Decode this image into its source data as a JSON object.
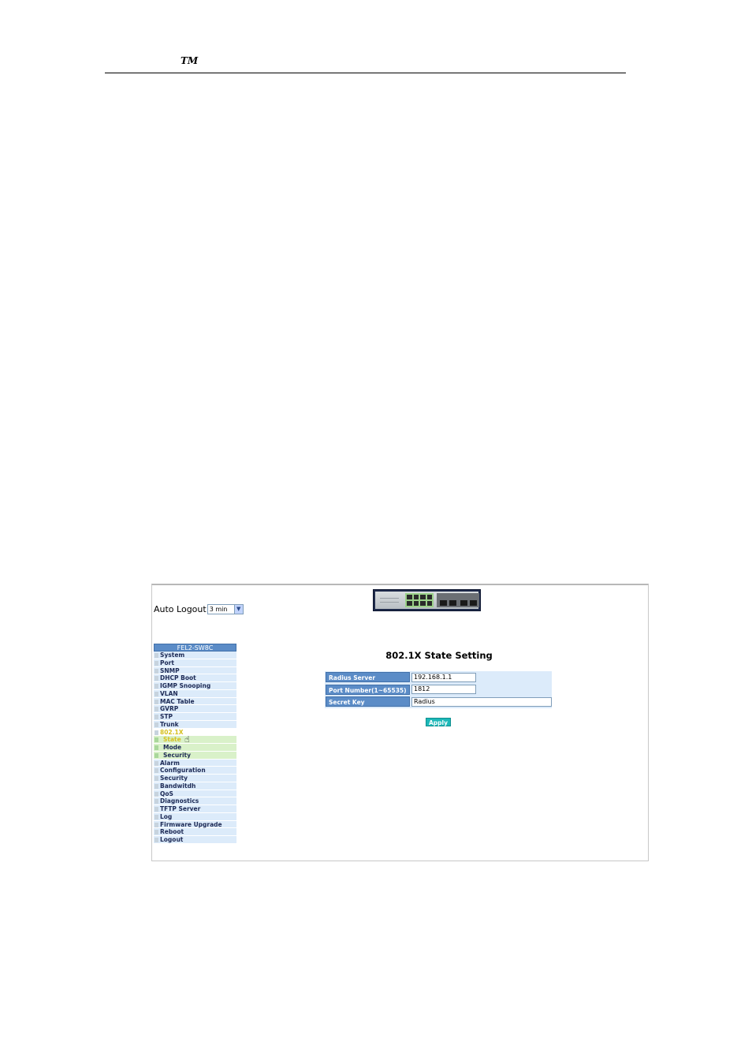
{
  "document": {
    "header_mark": "TM"
  },
  "auto_logout": {
    "label": "Auto Logout",
    "selected": "3 min"
  },
  "menu": {
    "title": "FEL2-SW8C",
    "items": [
      {
        "label": "System",
        "state": "normal"
      },
      {
        "label": "Port",
        "state": "normal"
      },
      {
        "label": "SNMP",
        "state": "normal"
      },
      {
        "label": "DHCP Boot",
        "state": "normal"
      },
      {
        "label": "IGMP Snooping",
        "state": "normal"
      },
      {
        "label": "VLAN",
        "state": "normal"
      },
      {
        "label": "MAC Table",
        "state": "normal"
      },
      {
        "label": "GVRP",
        "state": "normal"
      },
      {
        "label": "STP",
        "state": "normal"
      },
      {
        "label": "Trunk",
        "state": "normal"
      },
      {
        "label": "802.1X",
        "state": "active"
      },
      {
        "label": "State",
        "state": "sub-current"
      },
      {
        "label": "Mode",
        "state": "sub"
      },
      {
        "label": "Security",
        "state": "sub"
      },
      {
        "label": "Alarm",
        "state": "normal"
      },
      {
        "label": "Configuration",
        "state": "normal"
      },
      {
        "label": "Security",
        "state": "normal"
      },
      {
        "label": "Bandwitdh",
        "state": "normal"
      },
      {
        "label": "QoS",
        "state": "normal"
      },
      {
        "label": "Diagnostics",
        "state": "normal"
      },
      {
        "label": "TFTP Server",
        "state": "normal"
      },
      {
        "label": "Log",
        "state": "normal"
      },
      {
        "label": "Firmware Upgrade",
        "state": "normal"
      },
      {
        "label": "Reboot",
        "state": "normal"
      },
      {
        "label": "Logout",
        "state": "normal"
      }
    ]
  },
  "form": {
    "title": "802.1X State Setting",
    "fields": [
      {
        "label": "Radius Server",
        "value": "192.168.1.1"
      },
      {
        "label": "Port Number(1~65535)",
        "value": "1812"
      },
      {
        "label": "Secret Key",
        "value": "Radius"
      }
    ],
    "apply_label": "Apply"
  },
  "icons": {
    "cursor": "hand-pointer-icon",
    "dropdown": "chevron-down-icon",
    "device": "switch-device-icon"
  },
  "colors": {
    "menu_bg": "#dcebfa",
    "menu_title_bg": "#5b8cc7",
    "submenu_bg": "#d9f1c9",
    "active_text": "#d6c020",
    "apply_bg": "#1cb8b8"
  }
}
